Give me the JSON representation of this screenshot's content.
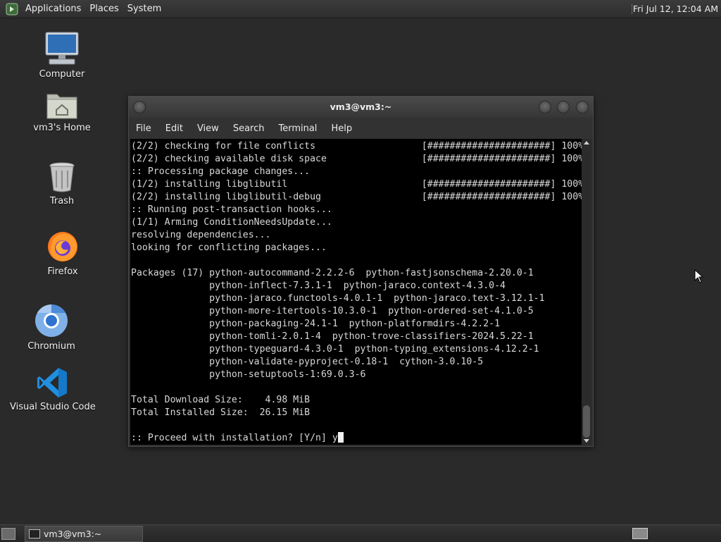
{
  "top_panel": {
    "menus": [
      "Applications",
      "Places",
      "System"
    ],
    "clock": "Fri Jul 12, 12:04 AM"
  },
  "desktop": {
    "icons": [
      {
        "label": "Computer",
        "icon": "computer-icon"
      },
      {
        "label": "vm3's Home",
        "icon": "home-folder-icon"
      },
      {
        "label": "Trash",
        "icon": "trash-icon"
      },
      {
        "label": "Firefox",
        "icon": "firefox-icon"
      },
      {
        "label": "Chromium",
        "icon": "chromium-icon"
      },
      {
        "label": "Visual Studio Code",
        "icon": "vscode-icon"
      }
    ]
  },
  "window": {
    "title": "vm3@vm3:~",
    "menus": [
      "File",
      "Edit",
      "View",
      "Search",
      "Terminal",
      "Help"
    ]
  },
  "terminal": {
    "lines": [
      "(2/2) checking for file conflicts                   [######################] 100%",
      "(2/2) checking available disk space                 [######################] 100%",
      ":: Processing package changes...",
      "(1/2) installing libglibutil                        [######################] 100%",
      "(2/2) installing libglibutil-debug                  [######################] 100%",
      ":: Running post-transaction hooks...",
      "(1/1) Arming ConditionNeedsUpdate...",
      "resolving dependencies...",
      "looking for conflicting packages...",
      "",
      "Packages (17) python-autocommand-2.2.2-6  python-fastjsonschema-2.20.0-1",
      "              python-inflect-7.3.1-1  python-jaraco.context-4.3.0-4",
      "              python-jaraco.functools-4.0.1-1  python-jaraco.text-3.12.1-1",
      "              python-more-itertools-10.3.0-1  python-ordered-set-4.1.0-5",
      "              python-packaging-24.1-1  python-platformdirs-4.2.2-1",
      "              python-tomli-2.0.1-4  python-trove-classifiers-2024.5.22-1",
      "              python-typeguard-4.3.0-1  python-typing_extensions-4.12.2-1",
      "              python-validate-pyproject-0.18-1  cython-3.0.10-5",
      "              python-setuptools-1:69.0.3-6",
      "",
      "Total Download Size:    4.98 MiB",
      "Total Installed Size:  26.15 MiB",
      ""
    ],
    "prompt": ":: Proceed with installation? [Y/n] ",
    "input": "y"
  },
  "bottom_panel": {
    "task_label": "vm3@vm3:~"
  }
}
